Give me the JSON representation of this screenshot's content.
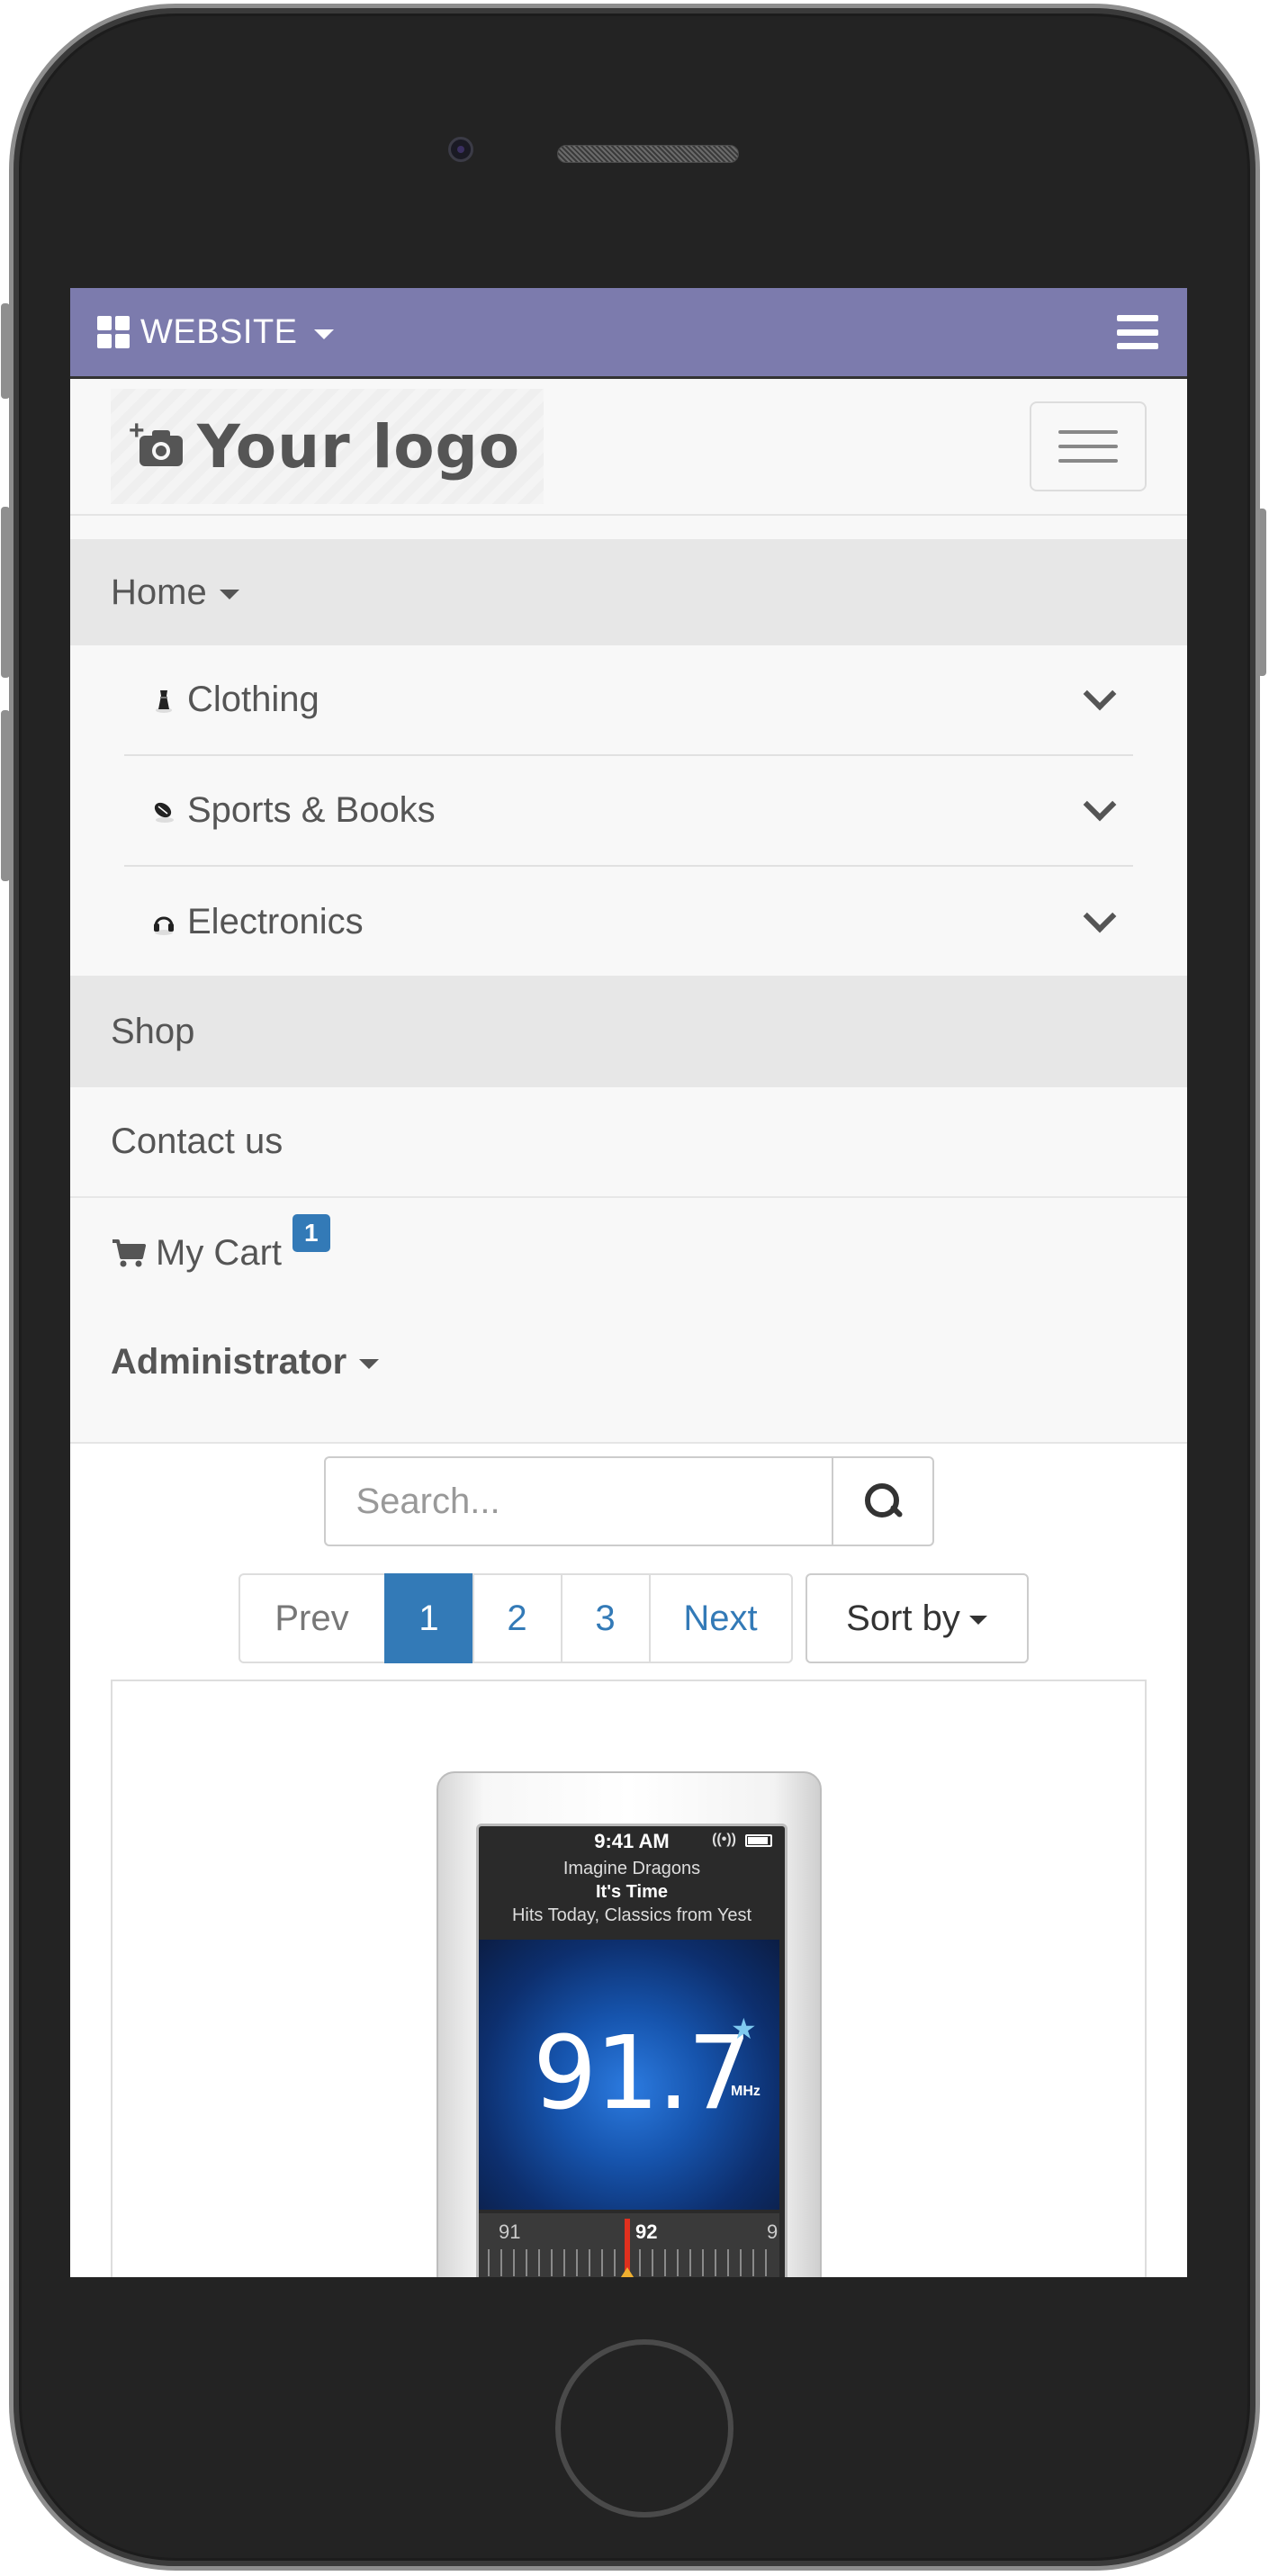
{
  "topbar": {
    "title": "WEBSITE"
  },
  "brand": {
    "logo_text": "Your logo"
  },
  "menu": {
    "home": "Home",
    "categories": [
      {
        "label": "Clothing",
        "icon": "dress-icon"
      },
      {
        "label": "Sports & Books",
        "icon": "football-icon"
      },
      {
        "label": "Electronics",
        "icon": "headphones-icon"
      }
    ],
    "shop": "Shop",
    "contact": "Contact us",
    "cart": {
      "label": "My Cart",
      "count": "1"
    },
    "user": "Administrator"
  },
  "search": {
    "placeholder": "Search...",
    "value": ""
  },
  "pagination": {
    "prev": "Prev",
    "pages": [
      "1",
      "2",
      "3"
    ],
    "current": "1",
    "next": "Next"
  },
  "sort": {
    "label": "Sort by"
  },
  "product": {
    "image": "ipod-nano-icon",
    "screen": {
      "time": "9:41 AM",
      "artist": "Imagine Dragons",
      "song": "It's Time",
      "station": "Hits Today, Classics from Yest",
      "frequency": "91.7",
      "unit": "MHz",
      "tuner_left": "91",
      "tuner_center": "92",
      "tuner_right": "9"
    }
  },
  "colors": {
    "topbar": "#7c7bad",
    "accent": "#337ab7",
    "active_menu": "#e7e7e7"
  }
}
